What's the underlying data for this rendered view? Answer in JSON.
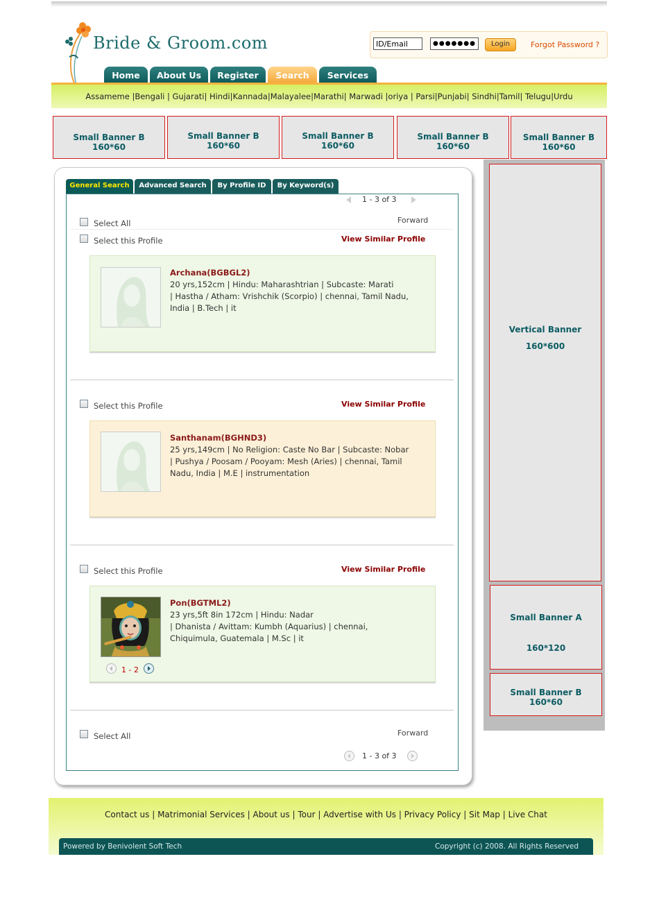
{
  "header": {
    "site_name": "Bride & Groom.com",
    "login": {
      "email_value": "ID/Email",
      "password_value": "●●●●●●●●",
      "button": "Login",
      "forgot": "Forgot Password ?"
    }
  },
  "nav": {
    "tabs": [
      "Home",
      "About Us",
      "Register",
      "Search",
      "Services"
    ],
    "active": "Search"
  },
  "languages": "Assameme |Bengali | Gujarati| Hindi|Kannada|Malayalee|Marathi| Marwadi |oriya | Parsi|Punjabi| Sindhi|Tamil| Telugu|Urdu",
  "banners": {
    "top": [
      {
        "line1": "Small Banner B",
        "line2": "160*60"
      },
      {
        "line1": "Small Banner B",
        "line2": "160*60"
      },
      {
        "line1": "Small Banner B",
        "line2": "160*60"
      },
      {
        "line1": "Small Banner B",
        "line2": "160*60"
      },
      {
        "line1": "Small Banner B",
        "line2": "160*60"
      }
    ],
    "vertical": {
      "line1": "Vertical Banner",
      "line2": "160*600"
    },
    "small_a": {
      "line1": "Small Banner A",
      "line2": "160*120"
    },
    "small_b": {
      "line1": "Small Banner B",
      "line2": "160*60"
    }
  },
  "search_tabs": [
    "General Search",
    "Advanced Search",
    "By Profile ID",
    "By Keyword(s)"
  ],
  "results": {
    "pager_text": "1 - 3 of 3",
    "select_all": "Select All",
    "forward": "Forward",
    "select_profile": "Select this Profile",
    "view_similar": "View Similar Profile",
    "profiles": [
      {
        "name": "Archana(BGBGL2)",
        "line1": "20 yrs,152cm | Hindu: Maharashtrian | Subcaste: Marati",
        "line2": "| Hastha / Atham: Vrishchik (Scorpio) | chennai, Tamil Nadu,",
        "line3": "India | B.Tech | it"
      },
      {
        "name": "Santhanam(BGHND3)",
        "line1": "25 yrs,149cm | No Religion: Caste No Bar | Subcaste: Nobar",
        "line2": "| Pushya / Poosam / Pooyam: Mesh (Aries) | chennai, Tamil",
        "line3": "Nadu, India | M.E | instrumentation"
      },
      {
        "name": "Pon(BGTML2)",
        "line1": "23 yrs,5ft 8in 172cm | Hindu: Nadar",
        "line2": "| Dhanista / Avittam: Kumbh (Aquarius) | chennai,",
        "line3": "Chiquimula, Guatemala | M.Sc | it",
        "photo_pager": "1 - 2"
      }
    ]
  },
  "footer": {
    "links": "Contact us | Matrimonial Services | About us | Tour | Advertise with Us | Privacy Policy | Sit Map | Live Chat",
    "powered": "Powered by Benivolent Soft Tech",
    "copyright": "Copyright (c) 2008. All Rights Reserved"
  },
  "colors": {
    "teal": "#0d5c63",
    "orange": "#f4a83a",
    "lime": "#d5ef64",
    "banner_border": "#d31a1a",
    "name_red": "#8b1a1a"
  }
}
